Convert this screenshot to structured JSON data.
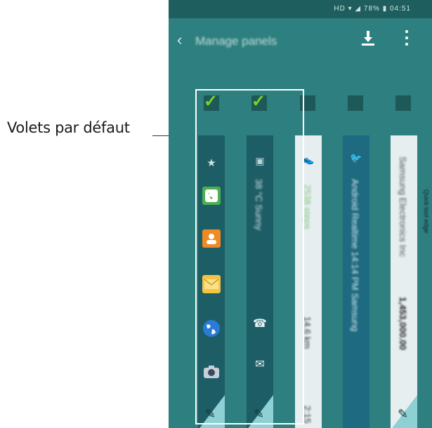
{
  "callout": {
    "label": "Volets par défaut"
  },
  "statusbar": {
    "text": "HD ▾ ◢ 78% ▮ 04:51"
  },
  "appbar": {
    "back_glyph": "‹",
    "title": "Manage panels"
  },
  "panels": [
    {
      "name": "default-panel-1",
      "checked": true,
      "type": "shortcuts",
      "icons": [
        "star-icon",
        "phone-icon",
        "contacts-icon",
        "email-icon",
        "internet-icon",
        "camera-icon"
      ],
      "edit_glyph": "✎"
    },
    {
      "name": "default-panel-2",
      "checked": true,
      "type": "notifications",
      "text": "38 °C Sunny",
      "icons": [
        "calendar-icon",
        "missed-call-icon",
        "message-icon"
      ],
      "edit_glyph": "✎"
    },
    {
      "name": "panel-3",
      "checked": false,
      "type": "light",
      "text_top": "2538 steps",
      "text_bottom": "14.6 km",
      "extra": "2:15"
    },
    {
      "name": "panel-4",
      "checked": false,
      "type": "blue",
      "text": "Android  Realtime  14:14 PM  Samsung"
    },
    {
      "name": "panel-5",
      "checked": false,
      "type": "light",
      "text_top": "Samsung Electronics Inc",
      "text_bottom": "1,453,000.00",
      "edit_glyph": "✎"
    }
  ],
  "edge_label": "Quick tool edge",
  "colors": {
    "phone_bg": "#2e7f7f",
    "check": "#7ed321",
    "selection_border": "#ffffff"
  }
}
